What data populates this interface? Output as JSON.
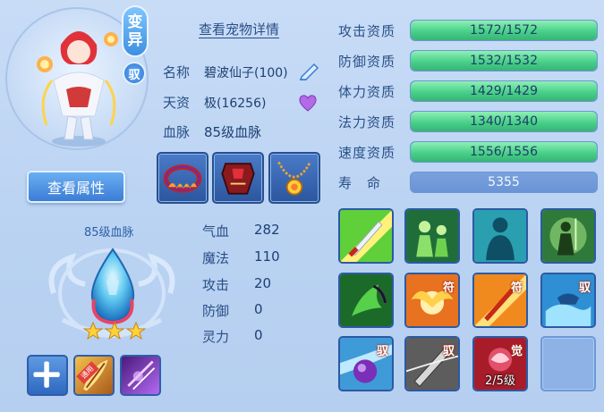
{
  "pet": {
    "badge_transform_line1": "变",
    "badge_transform_line2": "异",
    "badge_yu": "驭",
    "detail_link": "查看宠物详情",
    "name_key": "名称",
    "name_value": "碧波仙子(100)",
    "aptitude_key": "天资",
    "aptitude_value": "极(16256)",
    "bloodline_key": "血脉",
    "bloodline_value": "85级血脉",
    "view_attr_button": "查看属性"
  },
  "bloodline_panel": {
    "label": "85级血脉",
    "stars": 3
  },
  "bottom_slots": {
    "tag_text": "通用"
  },
  "stats": [
    {
      "key": "气血",
      "value": "282"
    },
    {
      "key": "魔法",
      "value": "110"
    },
    {
      "key": "攻击",
      "value": "20"
    },
    {
      "key": "防御",
      "value": "0"
    },
    {
      "key": "灵力",
      "value": "0"
    }
  ],
  "qualities": [
    {
      "key": "攻击资质",
      "text": "1572/1572",
      "fill": 1.0
    },
    {
      "key": "防御资质",
      "text": "1532/1532",
      "fill": 1.0
    },
    {
      "key": "体力资质",
      "text": "1429/1429",
      "fill": 1.0
    },
    {
      "key": "法力资质",
      "text": "1340/1340",
      "fill": 1.0
    },
    {
      "key": "速度资质",
      "text": "1556/1556",
      "fill": 1.0
    }
  ],
  "lifespan": {
    "key": "寿　命",
    "value": "5355"
  },
  "skills": {
    "badge_fu": "符",
    "badge_yu": "驭",
    "badge_jue": "觉",
    "level_text": "2/5级"
  },
  "colors": {
    "bar_fill": "#49d08a",
    "accent_blue": "#3b7dd6",
    "text_blue": "#2a4f86"
  }
}
